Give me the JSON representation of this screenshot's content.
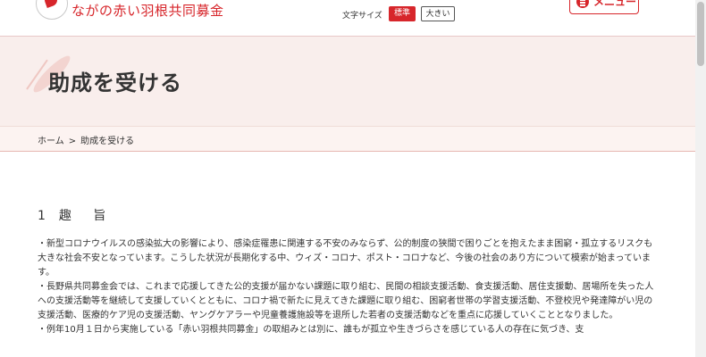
{
  "header": {
    "site_title": "ながの赤い羽根共同募金",
    "font_size_label": "文字サイズ",
    "font_size_standard": "標準",
    "font_size_large": "大きい",
    "menu_label": "メニュー"
  },
  "hero": {
    "title": "助成を受ける"
  },
  "breadcrumb": {
    "home": "ホーム",
    "separator": ">",
    "current": "助成を受ける"
  },
  "content": {
    "section_number": "1",
    "section_title": "趣 旨",
    "paragraphs": [
      "・新型コロナウイルスの感染拡大の影響により、感染症罹患に関連する不安のみならず、公的制度の狭間で困りごとを抱えたまま困窮・孤立するリスクも大きな社会不安となっています。こうした状況が長期化する中、ウィズ・コロナ、ポスト・コロナなど、今後の社会のあり方について模索が始まっています。",
      "・長野県共同募金会では、これまで応援してきた公的支援が届かない課題に取り組む、民間の相談支援活動、食支援活動、居住支援動、居場所を失った人への支援活動等を継続して支援していくとともに、コロナ禍で新たに見えてきた課題に取り組む、困窮者世帯の学習支援活動、不登校児や発達障がい児の支援活動、医療的ケア児の支援活動、ヤングケアラーや児童養護施設等を退所した若者の支援活動などを重点に応援していくこととなりました。",
      "・例年10月１日から実施している「赤い羽根共同募金」の取組みとは別に、誰もが孤立や生きづらさを感じている人の存在に気づき、支"
    ]
  },
  "colors": {
    "brand_red": "#d7262b",
    "hero_bg": "#f9eeec",
    "breadcrumb_bg": "#fcf3f1"
  },
  "icons": {
    "logo": "red-feather-logo-icon",
    "menu": "hamburger-icon"
  }
}
